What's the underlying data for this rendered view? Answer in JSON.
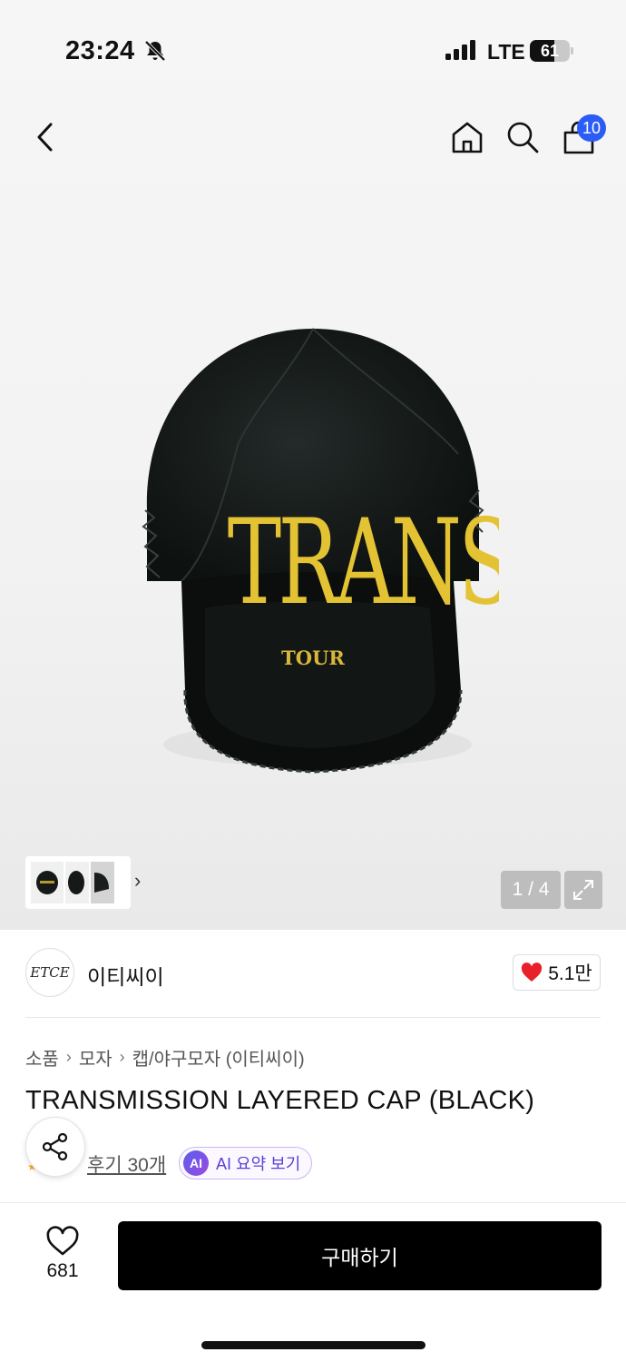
{
  "status_bar": {
    "time": "23:24",
    "network": "LTE",
    "battery": "61",
    "battery_level": 0.61
  },
  "top_nav": {
    "back_icon": "chevron-left-icon",
    "home_icon": "home-icon",
    "search_icon": "search-icon",
    "cart_icon": "shopping-bag-icon",
    "cart_badge": "10"
  },
  "product_image": {
    "embroidery_main": "TRANSMISSION",
    "embroidery_sub": "TOUR"
  },
  "gallery": {
    "page_indicator": "1 / 4",
    "thumbnail_count": 3
  },
  "brand": {
    "logo_text": "ETCE",
    "name": "이티씨이",
    "likes": "5.1만"
  },
  "breadcrumb": [
    "소품",
    "모자",
    "캡/야구모자 (이티씨이)"
  ],
  "product": {
    "title": "TRANSMISSION LAYERED CAP (BLACK)",
    "reviews_link": "후기 30개",
    "ai_badge": "AI",
    "ai_summary": "AI 요약 보기"
  },
  "bottom_bar": {
    "wish_count": "681",
    "buy_label": "구매하기"
  },
  "colors": {
    "badge_blue": "#2b5cf6",
    "heart_red": "#e8202a",
    "ai_purple": "#5b3fd6",
    "buy_button": "#000000"
  }
}
